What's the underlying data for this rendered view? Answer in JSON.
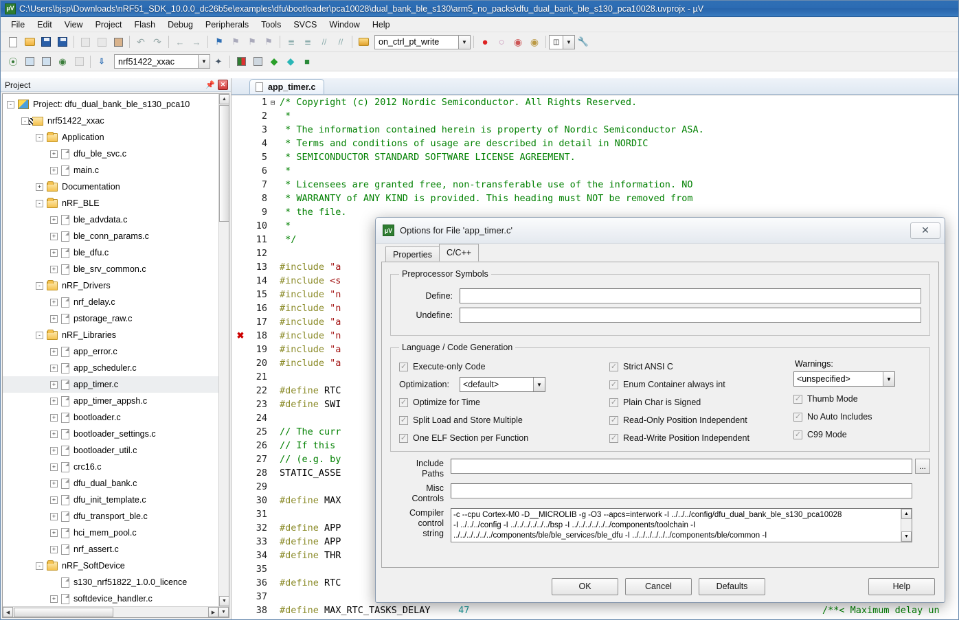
{
  "window": {
    "title": "C:\\Users\\bjsp\\Downloads\\nRF51_SDK_10.0.0_dc26b5e\\examples\\dfu\\bootloader\\pca10028\\dual_bank_ble_s130\\arm5_no_packs\\dfu_dual_bank_ble_s130_pca10028.uvprojx - µV",
    "app_icon": "keil-uvision-icon"
  },
  "menubar": {
    "items": [
      "File",
      "Edit",
      "View",
      "Project",
      "Flash",
      "Debug",
      "Peripherals",
      "Tools",
      "SVCS",
      "Window",
      "Help"
    ]
  },
  "toolbar1": {
    "combo_value": "on_ctrl_pt_write",
    "icons": [
      "new-file-icon",
      "open-file-icon",
      "save-icon",
      "save-all-icon",
      "cut-icon",
      "copy-icon",
      "paste-icon",
      "undo-icon",
      "redo-icon",
      "navigate-back-icon",
      "navigate-forward-icon",
      "bookmark-toggle-icon",
      "bookmark-prev-icon",
      "bookmark-next-icon",
      "bookmark-clear-icon",
      "indent-icon",
      "outdent-icon",
      "comment-icon",
      "uncomment-icon",
      "build-icon"
    ],
    "right_icons": [
      "breakpoint-icon",
      "breakpoint-disable-icon",
      "breakpoint-kill-icon",
      "breakpoint-disable-all-icon",
      "window-layout-icon",
      "configure-icon"
    ]
  },
  "toolbar2": {
    "combo_value": "nrf51422_xxac",
    "icons": [
      "translate-icon",
      "build-target-icon",
      "rebuild-icon",
      "batch-build-icon",
      "stop-build-icon",
      "download-icon"
    ],
    "right_icons": [
      "magic-wand-icon",
      "target-options-icon",
      "manage-components-icon",
      "green-diamond-icon",
      "cyan-diamond-icon",
      "pack-installer-icon"
    ]
  },
  "project_panel": {
    "title": "Project",
    "pin_icon": "pin-icon",
    "close_icon": "close-icon",
    "tree": [
      {
        "label": "Project: dfu_dual_bank_ble_s130_pca10",
        "depth": 0,
        "icon": "project-icon",
        "expander": "-"
      },
      {
        "label": "nrf51422_xxac",
        "depth": 1,
        "icon": "target-icon",
        "expander": "-"
      },
      {
        "label": "Application",
        "depth": 2,
        "icon": "folder-icon",
        "expander": "-"
      },
      {
        "label": "dfu_ble_svc.c",
        "depth": 3,
        "icon": "file-icon",
        "expander": "+"
      },
      {
        "label": "main.c",
        "depth": 3,
        "icon": "file-icon",
        "expander": "+"
      },
      {
        "label": "Documentation",
        "depth": 2,
        "icon": "folder-icon",
        "expander": "+"
      },
      {
        "label": "nRF_BLE",
        "depth": 2,
        "icon": "folder-icon",
        "expander": "-"
      },
      {
        "label": "ble_advdata.c",
        "depth": 3,
        "icon": "file-icon",
        "expander": "+"
      },
      {
        "label": "ble_conn_params.c",
        "depth": 3,
        "icon": "file-icon",
        "expander": "+"
      },
      {
        "label": "ble_dfu.c",
        "depth": 3,
        "icon": "file-icon",
        "expander": "+"
      },
      {
        "label": "ble_srv_common.c",
        "depth": 3,
        "icon": "file-icon",
        "expander": "+"
      },
      {
        "label": "nRF_Drivers",
        "depth": 2,
        "icon": "folder-icon",
        "expander": "-"
      },
      {
        "label": "nrf_delay.c",
        "depth": 3,
        "icon": "file-icon",
        "expander": "+"
      },
      {
        "label": "pstorage_raw.c",
        "depth": 3,
        "icon": "file-icon",
        "expander": "+"
      },
      {
        "label": "nRF_Libraries",
        "depth": 2,
        "icon": "folder-icon",
        "expander": "-"
      },
      {
        "label": "app_error.c",
        "depth": 3,
        "icon": "file-icon",
        "expander": "+"
      },
      {
        "label": "app_scheduler.c",
        "depth": 3,
        "icon": "file-icon",
        "expander": "+"
      },
      {
        "label": "app_timer.c",
        "depth": 3,
        "icon": "file-icon",
        "expander": "+",
        "selected": true
      },
      {
        "label": "app_timer_appsh.c",
        "depth": 3,
        "icon": "file-icon",
        "expander": "+"
      },
      {
        "label": "bootloader.c",
        "depth": 3,
        "icon": "file-icon",
        "expander": "+"
      },
      {
        "label": "bootloader_settings.c",
        "depth": 3,
        "icon": "file-icon",
        "expander": "+"
      },
      {
        "label": "bootloader_util.c",
        "depth": 3,
        "icon": "file-icon",
        "expander": "+"
      },
      {
        "label": "crc16.c",
        "depth": 3,
        "icon": "file-icon",
        "expander": "+"
      },
      {
        "label": "dfu_dual_bank.c",
        "depth": 3,
        "icon": "file-icon",
        "expander": "+"
      },
      {
        "label": "dfu_init_template.c",
        "depth": 3,
        "icon": "file-icon",
        "expander": "+"
      },
      {
        "label": "dfu_transport_ble.c",
        "depth": 3,
        "icon": "file-icon",
        "expander": "+"
      },
      {
        "label": "hci_mem_pool.c",
        "depth": 3,
        "icon": "file-icon",
        "expander": "+"
      },
      {
        "label": "nrf_assert.c",
        "depth": 3,
        "icon": "file-icon",
        "expander": "+"
      },
      {
        "label": "nRF_SoftDevice",
        "depth": 2,
        "icon": "folder-icon",
        "expander": "-"
      },
      {
        "label": "s130_nrf51822_1.0.0_licence",
        "depth": 3,
        "icon": "file-icon",
        "expander": ""
      },
      {
        "label": "softdevice_handler.c",
        "depth": 3,
        "icon": "file-icon",
        "expander": "+"
      }
    ]
  },
  "editor": {
    "tab_label": "app_timer.c",
    "tab_icon": "c-file-icon",
    "lines": [
      {
        "n": 1,
        "fold": "-",
        "segs": [
          {
            "t": "/* Copyright (c) 2012 Nordic Semiconductor. All Rights Reserved.",
            "c": "cm"
          }
        ]
      },
      {
        "n": 2,
        "segs": [
          {
            "t": " *",
            "c": "cm"
          }
        ]
      },
      {
        "n": 3,
        "segs": [
          {
            "t": " * The information contained herein is property of Nordic Semiconductor ASA.",
            "c": "cm"
          }
        ]
      },
      {
        "n": 4,
        "segs": [
          {
            "t": " * Terms and conditions of usage are described in detail in NORDIC",
            "c": "cm"
          }
        ]
      },
      {
        "n": 5,
        "segs": [
          {
            "t": " * SEMICONDUCTOR STANDARD SOFTWARE LICENSE AGREEMENT.",
            "c": "cm"
          }
        ]
      },
      {
        "n": 6,
        "segs": [
          {
            "t": " *",
            "c": "cm"
          }
        ]
      },
      {
        "n": 7,
        "segs": [
          {
            "t": " * Licensees are granted free, non-transferable use of the information. NO",
            "c": "cm"
          }
        ]
      },
      {
        "n": 8,
        "segs": [
          {
            "t": " * WARRANTY of ANY KIND is provided. This heading must NOT be removed from",
            "c": "cm"
          }
        ]
      },
      {
        "n": 9,
        "segs": [
          {
            "t": " * the file.",
            "c": "cm"
          }
        ]
      },
      {
        "n": 10,
        "segs": [
          {
            "t": " *",
            "c": "cm"
          }
        ]
      },
      {
        "n": 11,
        "segs": [
          {
            "t": " */",
            "c": "cm"
          }
        ]
      },
      {
        "n": 12,
        "segs": []
      },
      {
        "n": 13,
        "segs": [
          {
            "t": "#include ",
            "c": "pp"
          },
          {
            "t": "\"a",
            "c": "st"
          }
        ]
      },
      {
        "n": 14,
        "segs": [
          {
            "t": "#include ",
            "c": "pp"
          },
          {
            "t": "<s",
            "c": "st"
          }
        ]
      },
      {
        "n": 15,
        "segs": [
          {
            "t": "#include ",
            "c": "pp"
          },
          {
            "t": "\"n",
            "c": "st"
          }
        ]
      },
      {
        "n": 16,
        "segs": [
          {
            "t": "#include ",
            "c": "pp"
          },
          {
            "t": "\"n",
            "c": "st"
          }
        ]
      },
      {
        "n": 17,
        "segs": [
          {
            "t": "#include ",
            "c": "pp"
          },
          {
            "t": "\"a",
            "c": "st"
          }
        ]
      },
      {
        "n": 18,
        "mark": "✖",
        "segs": [
          {
            "t": "#include ",
            "c": "pp"
          },
          {
            "t": "\"n",
            "c": "st"
          }
        ]
      },
      {
        "n": 19,
        "segs": [
          {
            "t": "#include ",
            "c": "pp"
          },
          {
            "t": "\"a",
            "c": "st"
          }
        ]
      },
      {
        "n": 20,
        "segs": [
          {
            "t": "#include ",
            "c": "pp"
          },
          {
            "t": "\"a",
            "c": "st"
          }
        ]
      },
      {
        "n": 21,
        "segs": []
      },
      {
        "n": 22,
        "segs": [
          {
            "t": "#define ",
            "c": "pp"
          },
          {
            "t": "RTC",
            "c": "pl"
          }
        ]
      },
      {
        "n": 23,
        "segs": [
          {
            "t": "#define ",
            "c": "pp"
          },
          {
            "t": "SWI",
            "c": "pl"
          }
        ]
      },
      {
        "n": 24,
        "segs": []
      },
      {
        "n": 25,
        "segs": [
          {
            "t": "// The curr",
            "c": "cm"
          }
        ]
      },
      {
        "n": 26,
        "segs": [
          {
            "t": "// If this",
            "c": "cm"
          }
        ]
      },
      {
        "n": 27,
        "segs": [
          {
            "t": "// (e.g. by",
            "c": "cm"
          }
        ]
      },
      {
        "n": 28,
        "segs": [
          {
            "t": "STATIC_ASSE",
            "c": "pl"
          }
        ]
      },
      {
        "n": 29,
        "segs": []
      },
      {
        "n": 30,
        "segs": [
          {
            "t": "#define ",
            "c": "pp"
          },
          {
            "t": "MAX",
            "c": "pl"
          }
        ]
      },
      {
        "n": 31,
        "segs": []
      },
      {
        "n": 32,
        "segs": [
          {
            "t": "#define ",
            "c": "pp"
          },
          {
            "t": "APP",
            "c": "pl"
          }
        ]
      },
      {
        "n": 33,
        "segs": [
          {
            "t": "#define ",
            "c": "pp"
          },
          {
            "t": "APP",
            "c": "pl"
          }
        ]
      },
      {
        "n": 34,
        "segs": [
          {
            "t": "#define ",
            "c": "pp"
          },
          {
            "t": "THR",
            "c": "pl"
          }
        ]
      },
      {
        "n": 35,
        "segs": []
      },
      {
        "n": 36,
        "segs": [
          {
            "t": "#define ",
            "c": "pp"
          },
          {
            "t": "RTC",
            "c": "pl"
          }
        ]
      },
      {
        "n": 37,
        "segs": []
      },
      {
        "n": 38,
        "segs": [
          {
            "t": "#define ",
            "c": "pp"
          },
          {
            "t": "MAX_RTC_TASKS_DELAY     ",
            "c": "pl"
          },
          {
            "t": "47",
            "c": "nm"
          }
        ]
      }
    ],
    "trailing_comment_line38": "/**< Maximum delay un"
  },
  "dialog": {
    "title": "Options for File 'app_timer.c'",
    "icon": "keil-uvision-icon",
    "close_label": "✕",
    "tabs": [
      {
        "label": "Properties",
        "active": false
      },
      {
        "label": "C/C++",
        "active": true
      }
    ],
    "preprocessor": {
      "legend": "Preprocessor Symbols",
      "define_label": "Define:",
      "define_value": "",
      "undefine_label": "Undefine:",
      "undefine_value": ""
    },
    "language": {
      "legend": "Language / Code Generation",
      "col1": [
        {
          "label": "Execute-only Code",
          "checked": true
        },
        {
          "label": "Optimize for Time",
          "checked": true
        },
        {
          "label": "Split Load and Store Multiple",
          "checked": true
        },
        {
          "label": "One ELF Section per Function",
          "checked": true
        }
      ],
      "optimization_label": "Optimization:",
      "optimization_value": "<default>",
      "col2": [
        {
          "label": "Strict ANSI C",
          "checked": true
        },
        {
          "label": "Enum Container always int",
          "checked": true
        },
        {
          "label": "Plain Char is Signed",
          "checked": true
        },
        {
          "label": "Read-Only Position Independent",
          "checked": true
        },
        {
          "label": "Read-Write Position Independent",
          "checked": true
        }
      ],
      "warnings_label": "Warnings:",
      "warnings_value": "<unspecified>",
      "col3": [
        {
          "label": "Thumb Mode",
          "checked": true
        },
        {
          "label": "No Auto Includes",
          "checked": true
        },
        {
          "label": "C99 Mode",
          "checked": true
        }
      ]
    },
    "paths": {
      "include_label": "Include\nPaths",
      "include_value": "",
      "include_browse": "...",
      "misc_label": "Misc\nControls",
      "misc_value": "",
      "compiler_label": "Compiler\ncontrol\nstring",
      "compiler_lines": [
        "-c --cpu Cortex-M0 -D__MICROLIB -g -O3 --apcs=interwork -I ../../../config/dfu_dual_bank_ble_s130_pca10028",
        "-I ../../../config -I ../../../../../../bsp -I ../../../../../../components/toolchain -I",
        "../../../../../../components/ble/ble_services/ble_dfu -I ../../../../../../components/ble/common -I"
      ]
    },
    "buttons": {
      "ok": "OK",
      "cancel": "Cancel",
      "defaults": "Defaults",
      "help": "Help"
    }
  }
}
